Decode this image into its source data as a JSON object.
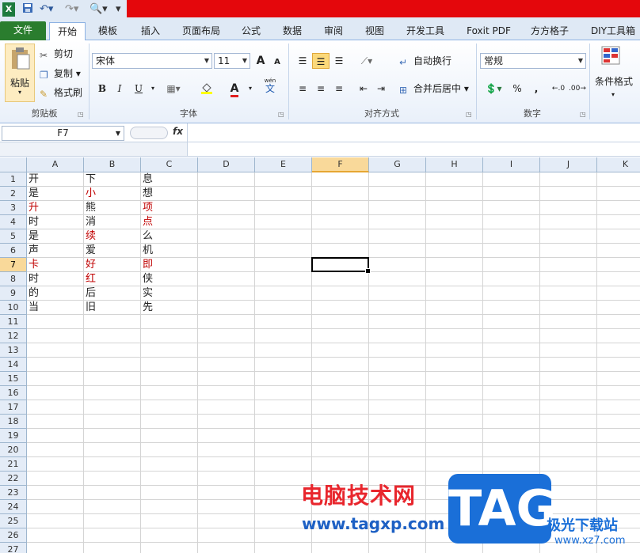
{
  "quick_access": {
    "overflow_glyph": "▾"
  },
  "tabs": {
    "file": "文件",
    "items": [
      "开始",
      "模板",
      "插入",
      "页面布局",
      "公式",
      "数据",
      "审阅",
      "视图",
      "开发工具",
      "Foxit PDF",
      "方方格子",
      "DIY工具箱"
    ]
  },
  "ribbon": {
    "clipboard": {
      "paste": "粘贴",
      "cut": "剪切",
      "copy": "复制",
      "format_painter": "格式刷",
      "label": "剪贴板"
    },
    "font": {
      "name": "宋体",
      "size": "11",
      "bold": "B",
      "italic": "I",
      "underline": "U",
      "grow": "A",
      "shrink": "A",
      "phonetic": "wén",
      "phonetic_char": "文",
      "font_color_letter": "A",
      "label": "字体"
    },
    "alignment": {
      "wrap": "自动换行",
      "merge": "合并后居中",
      "label": "对齐方式"
    },
    "number": {
      "format": "常规",
      "percent": "%",
      "comma": ",",
      "label": "数字"
    },
    "styles": {
      "conditional": "条件格式"
    }
  },
  "formula_bar": {
    "name_box": "F7",
    "fx": "fx"
  },
  "sheet": {
    "columns": [
      "A",
      "B",
      "C",
      "D",
      "E",
      "F",
      "G",
      "H",
      "I",
      "J",
      "K"
    ],
    "selected_column": "F",
    "selected_row": 7,
    "rows": 27,
    "red_color": "#c00000",
    "data": [
      [
        "开",
        "下",
        "息"
      ],
      [
        "是",
        "小",
        "想"
      ],
      [
        "升",
        "熊",
        "项"
      ],
      [
        "时",
        "消",
        "点"
      ],
      [
        "是",
        "续",
        "么"
      ],
      [
        "声",
        "爱",
        "机"
      ],
      [
        "卡",
        "好",
        "即"
      ],
      [
        "时",
        "红",
        "侠"
      ],
      [
        "的",
        "后",
        "实"
      ],
      [
        "当",
        "旧",
        "先"
      ]
    ],
    "red_cells": [
      [
        1,
        1
      ],
      [
        2,
        0
      ],
      [
        2,
        2
      ],
      [
        3,
        2
      ],
      [
        4,
        1
      ],
      [
        6,
        0
      ],
      [
        6,
        1
      ],
      [
        6,
        2
      ],
      [
        7,
        1
      ]
    ]
  },
  "watermark": {
    "title": "电脑技术网",
    "url": "www.tagxp.com",
    "logo": "TAG",
    "site": "极光下载站",
    "site_url": "www.xz7.com"
  }
}
